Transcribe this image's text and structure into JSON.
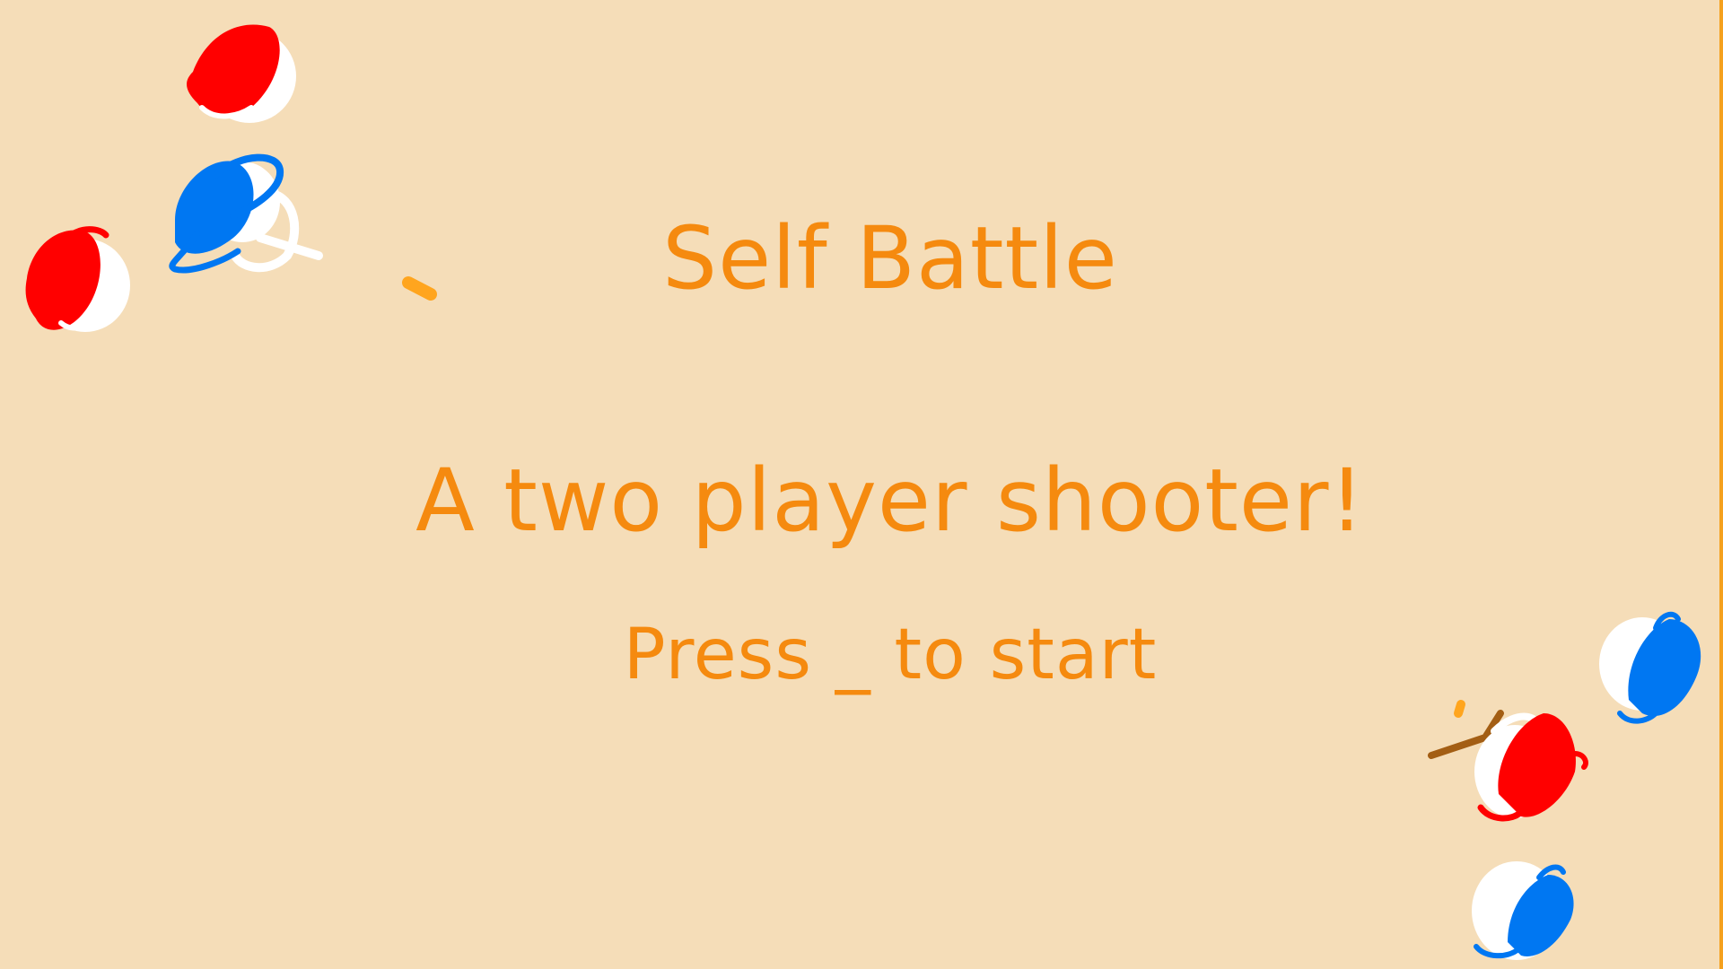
{
  "screen": {
    "title": "Self Battle",
    "subtitle": "A two player shooter!",
    "prompt": "Press _ to start"
  },
  "colors": {
    "background": "#f5ddb8",
    "text": "#f58a0f",
    "border": "#f5a11e",
    "player_red": "#ff0000",
    "player_blue": "#0077f2",
    "outline_white": "#ffffff",
    "bullet": "#ffa51e",
    "weapon": "#a35e14"
  },
  "entities": [
    {
      "kind": "red-player-icon",
      "team": "red"
    },
    {
      "kind": "blue-player-icon",
      "team": "blue"
    },
    {
      "kind": "red-player-icon",
      "team": "red"
    },
    {
      "kind": "bullet-icon",
      "team": "none"
    },
    {
      "kind": "blue-player-icon",
      "team": "blue"
    },
    {
      "kind": "red-player-icon",
      "team": "red"
    },
    {
      "kind": "blue-player-icon",
      "team": "blue"
    }
  ]
}
